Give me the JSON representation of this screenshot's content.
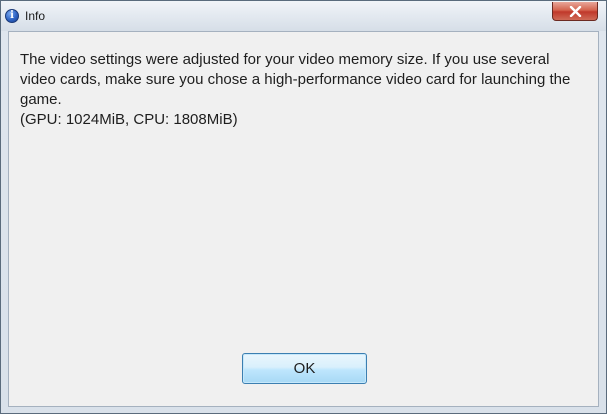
{
  "window": {
    "title": "Info",
    "title_icon": "info-icon",
    "close_icon": "close-icon"
  },
  "message": {
    "line1": "The video settings were adjusted for your video memory size. If you use several video cards, make sure you chose a high-performance video card for launching the game.",
    "line2": "(GPU: 1024MiB, CPU: 1808MiB)"
  },
  "buttons": {
    "ok_label": "OK"
  },
  "colors": {
    "close_button": "#c0392b",
    "ok_button_border": "#3c7fb1",
    "client_background": "#f0f0f0"
  }
}
